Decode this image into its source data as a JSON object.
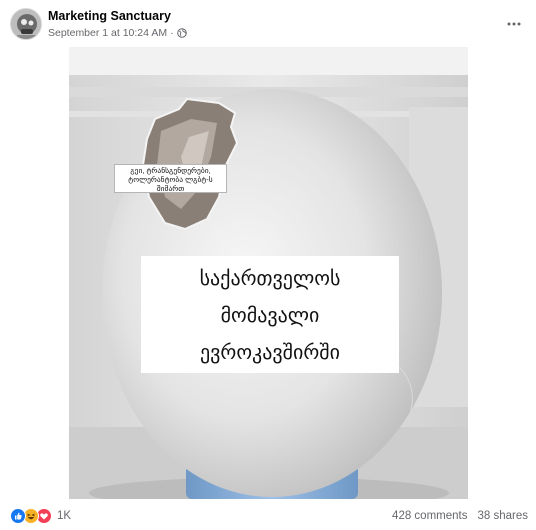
{
  "post": {
    "author": "Marketing Sanctuary",
    "timestamp": "September 1 at 10:24 AM",
    "separator": "·",
    "visibility_icon": "globe-icon",
    "more_icon": "more-horizontal-icon"
  },
  "image": {
    "small_caption": "გეი, ტრანსგენდერები, ტოლერანტობა ლგბტ-ს შიმართ",
    "main_caption": [
      "საქართველოს",
      "მომავალი",
      "ევროკავშირში"
    ]
  },
  "footer": {
    "reaction_icons": [
      "like-icon",
      "haha-icon",
      "love-icon"
    ],
    "reaction_count": "1K",
    "comments": "428 comments",
    "shares": "38 shares"
  },
  "colors": {
    "text_primary": "#050505",
    "text_secondary": "#65676b",
    "like_blue": "#1877f2",
    "haha_yellow": "#f7b125",
    "love_red": "#f33e58"
  }
}
